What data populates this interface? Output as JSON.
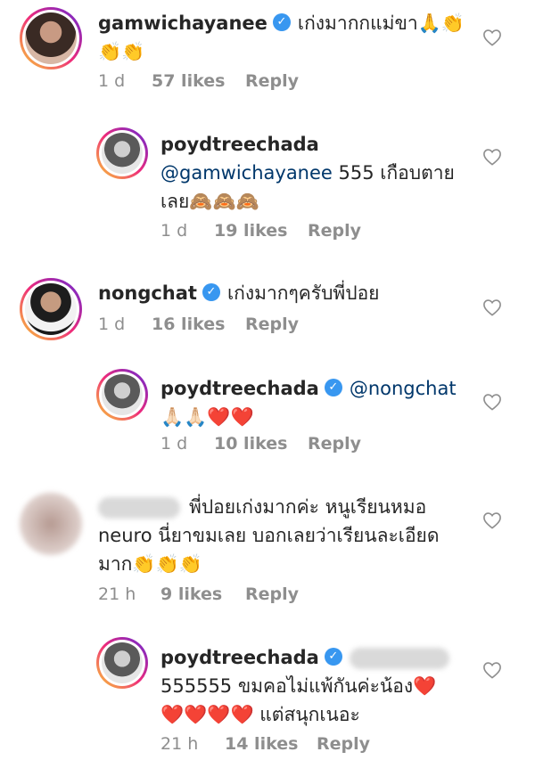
{
  "comments": [
    {
      "username": "gamwichayanee",
      "text": "เก่งมากกแม่ขา🙏👏👏👏",
      "time": "1 d",
      "likes": "57 likes",
      "reply": "Reply"
    },
    {
      "username": "poydtreechada",
      "mention": "@gamwichayanee",
      "text_line1": " 555 เกือบตาย",
      "text_line2": "เลย🙈🙈🙈",
      "time": "1 d",
      "likes": "19 likes",
      "reply": "Reply"
    },
    {
      "username": "nongchat",
      "text": "เก่งมากๆครับพี่ปอย",
      "time": "1 d",
      "likes": "16 likes",
      "reply": "Reply"
    },
    {
      "username": "poydtreechada",
      "mention": "@nongchat",
      "text_line2": "🙏🏻🙏🏻❤️❤️",
      "time": "1 d",
      "likes": "10 likes",
      "reply": "Reply"
    },
    {
      "text_line1": "พี่ปอยเก่งมากค่ะ หนูเรียนหมอ",
      "text_line2": "neuro นี่ยาขมเลย บอกเลยว่าเรียนละเอียด",
      "text_line3": "มาก👏👏👏",
      "time": "21 h",
      "likes": "9 likes",
      "reply": "Reply"
    },
    {
      "username": "poydtreechada",
      "text_line2": "555555 ขมคอไม่แพ้กันค่ะน้อง❤️",
      "text_line3": "❤️❤️❤️❤️ แต่สนุกเนอะ",
      "time": "21 h",
      "likes": "14 likes",
      "reply": "Reply"
    }
  ],
  "icons": {
    "verified": "verified-badge-icon",
    "like": "heart-outline-icon"
  },
  "colors": {
    "verified": "#3897f0",
    "mention": "#00376b",
    "meta": "#8e8e8e",
    "text": "#262626"
  }
}
